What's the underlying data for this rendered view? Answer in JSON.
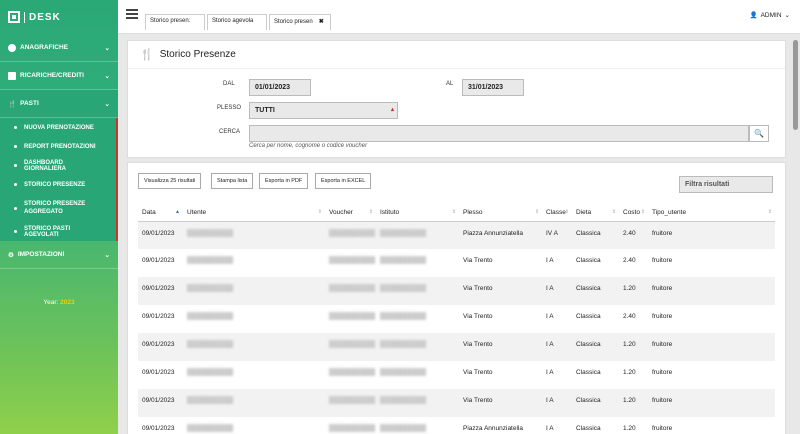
{
  "sidebar": {
    "brand": "DESK",
    "sections": [
      {
        "label": "ANAGRAFICHE"
      },
      {
        "label": "RICARICHE/CREDITI"
      },
      {
        "label": "PASTI"
      },
      {
        "label": "IMPOSTAZIONI"
      }
    ],
    "pasti_items": [
      "NUOVA PRENOTAZIONE",
      "REPORT PRENOTAZIONI",
      "DASHBOARD GIORNALIERA",
      "STORICO PRESENZE",
      "STORICO PRESENZE AGGREGATO",
      "STORICO PASTI AGEVOLATI"
    ],
    "year_label": "Year:",
    "year_value": "2023"
  },
  "topbar": {
    "tabs": [
      "Storico presen:",
      "Storico agevola",
      "Storico presen"
    ],
    "admin": "ADMIN"
  },
  "header": {
    "title": "Storico Presenze"
  },
  "form": {
    "dal_label": "DAL",
    "dal_value": "01/01/2023",
    "al_label": "AL",
    "al_value": "31/01/2023",
    "plesso_label": "PLESSO",
    "plesso_value": "TUTTI",
    "cerca_label": "CERCA",
    "cerca_hint": "Cerca per nome, cognome o codice voucher"
  },
  "toolbar": {
    "show25": "Visualizza 25 risultati",
    "print": "Stampa lista",
    "pdf": "Esporta in PDF",
    "excel": "Esporta in EXCEL",
    "filter_placeholder": "Filtra risultati"
  },
  "table": {
    "headers": [
      "Data",
      "Utente",
      "Voucher",
      "Istituto",
      "Plesso",
      "Classe",
      "Dieta",
      "Costo",
      "Tipo_utente"
    ],
    "rows": [
      [
        "09/01/2023",
        "",
        "",
        "",
        "Piazza Annunziatella",
        "IV A",
        "Classica",
        "2.40",
        "fruitore"
      ],
      [
        "09/01/2023",
        "",
        "",
        "",
        "Via Trento",
        "I A",
        "Classica",
        "2.40",
        "fruitore"
      ],
      [
        "09/01/2023",
        "",
        "",
        "",
        "Via Trento",
        "I A",
        "Classica",
        "1.20",
        "fruitore"
      ],
      [
        "09/01/2023",
        "",
        "",
        "",
        "Via Trento",
        "I A",
        "Classica",
        "2.40",
        "fruitore"
      ],
      [
        "09/01/2023",
        "",
        "",
        "",
        "Via Trento",
        "I A",
        "Classica",
        "1.20",
        "fruitore"
      ],
      [
        "09/01/2023",
        "",
        "",
        "",
        "Via Trento",
        "I A",
        "Classica",
        "1.20",
        "fruitore"
      ],
      [
        "09/01/2023",
        "",
        "",
        "",
        "Via Trento",
        "I A",
        "Classica",
        "1.20",
        "fruitore"
      ],
      [
        "09/01/2023",
        "",
        "",
        "",
        "Piazza Annunziatella",
        "I A",
        "Classica",
        "1.20",
        "fruitore"
      ]
    ]
  }
}
